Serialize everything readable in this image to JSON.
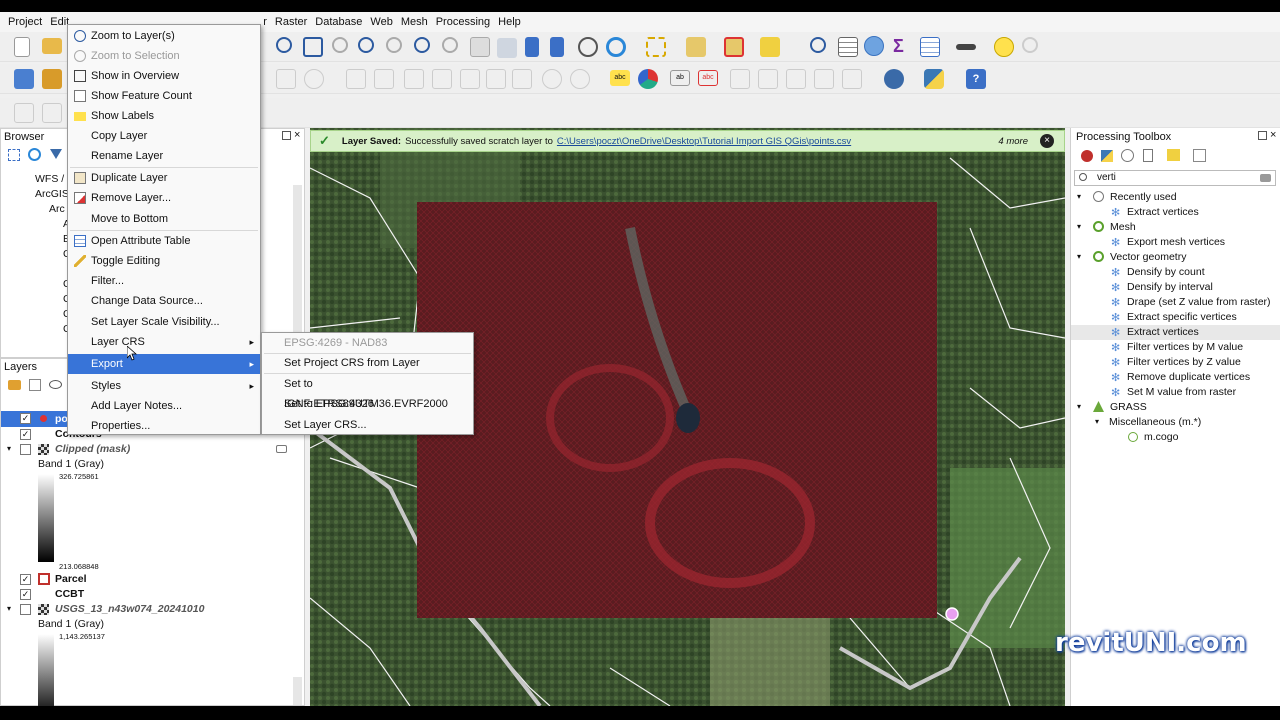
{
  "menubar": [
    "Project",
    "Edit",
    "r",
    "Raster",
    "Database",
    "Web",
    "Mesh",
    "Processing",
    "Help"
  ],
  "browser": {
    "title": "Browser",
    "items": [
      "WFS / O",
      "ArcGIS",
      "Arc G",
      "A",
      "B",
      "C",
      "C",
      "C",
      "C",
      "C"
    ]
  },
  "layers": {
    "title": "Layers",
    "items": {
      "points": "po",
      "contours": "Contours",
      "clipped": "Clipped (mask)",
      "band1": "Band 1 (Gray)",
      "max1": "326.725861",
      "min1": "213.068848",
      "parcel": "Parcel",
      "ccbt": "CCBT",
      "usgs": "USGS_13_n43w074_20241010",
      "band2": "Band 1 (Gray)",
      "max2": "1,143.265137"
    }
  },
  "message": {
    "title": "Layer Saved:",
    "text": "Successfully saved scratch layer to",
    "link": "C:\\Users\\poczt\\OneDrive\\Desktop\\Tutorial Import GIS QGis\\points.csv",
    "more": "4 more"
  },
  "context_menu": [
    {
      "label": "Zoom to Layer(s)",
      "disabled": false
    },
    {
      "label": "Zoom to Selection",
      "disabled": true
    },
    {
      "label": "Show in Overview",
      "disabled": false
    },
    {
      "label": "Show Feature Count",
      "disabled": false
    },
    {
      "label": "Show Labels",
      "disabled": false
    },
    {
      "label": "Copy Layer",
      "disabled": false
    },
    {
      "label": "Rename Layer",
      "disabled": false
    },
    {
      "label": "Duplicate Layer",
      "disabled": false
    },
    {
      "label": "Remove Layer...",
      "disabled": false
    },
    {
      "label": "Move to Bottom",
      "disabled": false
    },
    {
      "label": "Open Attribute Table",
      "disabled": false
    },
    {
      "label": "Toggle Editing",
      "disabled": false
    },
    {
      "label": "Filter...",
      "disabled": false
    },
    {
      "label": "Change Data Source...",
      "disabled": false
    },
    {
      "label": "Set Layer Scale Visibility...",
      "disabled": false
    },
    {
      "label": "Layer CRS",
      "disabled": false
    },
    {
      "label": "Export",
      "disabled": false
    },
    {
      "label": "Styles",
      "disabled": false
    },
    {
      "label": "Add Layer Notes...",
      "disabled": false
    },
    {
      "label": "Properties...",
      "disabled": false
    }
  ],
  "submenu": [
    {
      "label": "EPSG:4269 - NAD83",
      "disabled": true
    },
    {
      "label": "Set Project CRS from Layer",
      "disabled": false
    },
    {
      "label": "Set to IGNF:ETRS89UTM36.EVRF2000",
      "disabled": false
    },
    {
      "label": "Set to EPSG:4326",
      "disabled": false
    },
    {
      "label": "Set Layer CRS...",
      "disabled": false
    }
  ],
  "toolbox": {
    "title": "Processing Toolbox",
    "search": "verti",
    "groups": [
      {
        "name": "Recently used",
        "items": [
          "Extract vertices"
        ]
      },
      {
        "name": "Mesh",
        "items": [
          "Export mesh vertices"
        ]
      },
      {
        "name": "Vector geometry",
        "items": [
          "Densify by count",
          "Densify by interval",
          "Drape (set Z value from raster)",
          "Extract specific vertices",
          "Extract vertices",
          "Filter vertices by M value",
          "Filter vertices by Z value",
          "Remove duplicate vertices",
          "Set M value from raster"
        ]
      },
      {
        "name": "GRASS",
        "items": []
      },
      {
        "name": "Miscellaneous (m.*)",
        "items": [
          "m.cogo"
        ]
      }
    ]
  },
  "watermark": "revitUNI.com"
}
